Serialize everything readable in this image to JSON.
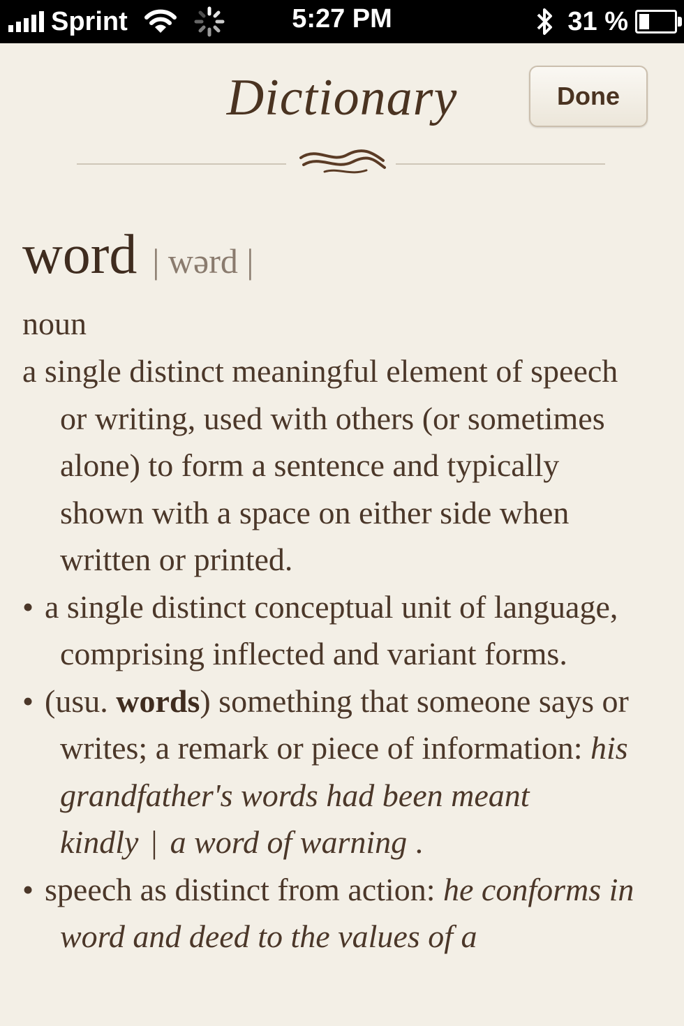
{
  "status_bar": {
    "carrier": "Sprint",
    "time": "5:27 PM",
    "battery_text": "31 %",
    "icons": [
      "signal-bars-icon",
      "wifi-icon",
      "activity-spinner-icon",
      "bluetooth-icon",
      "battery-icon"
    ]
  },
  "header": {
    "title": "Dictionary",
    "done_label": "Done"
  },
  "entry": {
    "headword": "word",
    "pronunciation": "| wərd |",
    "part_of_speech": "noun",
    "sense1": "a single distinct meaningful element of speech or writing, used with others (or sometimes alone) to form a sentence and typically shown with a space on either side when written or printed.",
    "sense2": "a single distinct conceptual unit of language, comprising inflected and variant forms.",
    "sense3_pre": "(usu. ",
    "sense3_bold": "words",
    "sense3_post": ") something that someone says or writes; a remark or piece of information: ",
    "sense3_example1": "his grandfather's words had been meant kindly",
    "sense3_separator": "|",
    "sense3_example2": "a word of warning",
    "sense3_end": " .",
    "sense4": "speech as distinct from action: ",
    "sense4_example": "he conforms in word and deed to the values of a",
    "bullet": "•"
  },
  "colors": {
    "background": "#f3efe6",
    "text": "#4b3729",
    "status_bar": "#000000"
  }
}
